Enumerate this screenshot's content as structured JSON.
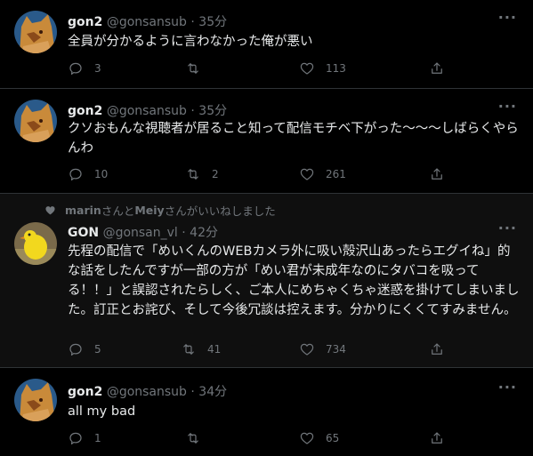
{
  "tweets": [
    {
      "name": "gon2",
      "handle": "@gonsansub",
      "time": "35分",
      "text": "全員が分かるように言わなかった俺が悪い",
      "replies": "3",
      "retweets": "",
      "likes": "113"
    },
    {
      "name": "gon2",
      "handle": "@gonsansub",
      "time": "35分",
      "text": "クソおもんな視聴者が居ること知って配信モチベ下がった～～～しばらくやらんわ",
      "replies": "10",
      "retweets": "2",
      "likes": "261"
    },
    {
      "liked_by_prefix": "marin",
      "liked_by_mid": "さんと",
      "liked_by_name2": "Meiy",
      "liked_by_suffix": "さんがいいねしました",
      "name": "GON",
      "handle": "@gonsan_vl",
      "time": "42分",
      "text": "先程の配信で「めいくんのWEBカメラ外に吸い殻沢山あったらエグイね」的な話をしたんですが一部の方が「めい君が未成年なのにタバコを吸ってる！！」と誤認されたらしく、ご本人にめちゃくちゃ迷惑を掛けてしまいました。訂正とお詫び、そして今後冗談は控えます。分かりにくくてすみません。",
      "replies": "5",
      "retweets": "41",
      "likes": "734"
    },
    {
      "name": "gon2",
      "handle": "@gonsansub",
      "time": "34分",
      "text": "all my bad",
      "replies": "1",
      "retweets": "",
      "likes": "65"
    }
  ],
  "separator": " · ",
  "more_glyph": "···",
  "icons": {
    "reply": "reply-icon",
    "retweet": "retweet-icon",
    "like": "heart-icon",
    "share": "share-icon",
    "liked_context": "heart-icon"
  },
  "colors": {
    "background": "#000000",
    "highlight_bg": "#0f0f0f",
    "text": "#e7e9ea",
    "muted": "#71767b",
    "divider": "#2f3336"
  }
}
